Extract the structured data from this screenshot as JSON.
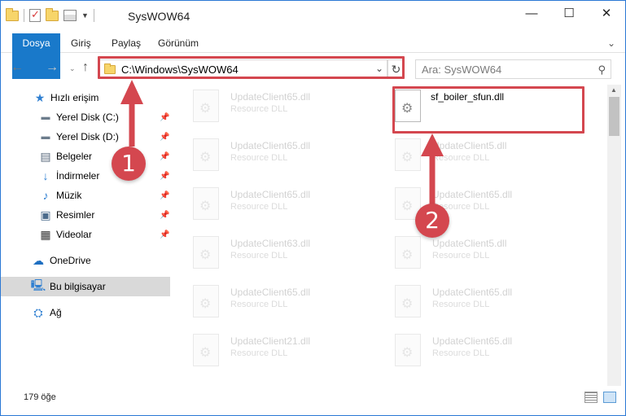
{
  "window": {
    "title": "SysWOW64",
    "minimize_glyph": "—",
    "maximize_glyph": "☐",
    "close_glyph": "✕"
  },
  "ribbon": {
    "tabs": [
      {
        "label": "Dosya"
      },
      {
        "label": "Giriş"
      },
      {
        "label": "Paylaş"
      },
      {
        "label": "Görünüm"
      }
    ]
  },
  "nav": {
    "address_value": "C:\\Windows\\SysWOW64",
    "search_placeholder": "Ara: SysWOW64"
  },
  "sidebar": {
    "items": [
      {
        "label": "Hızlı erişim",
        "icon": "star-icon"
      },
      {
        "label": "Yerel Disk (C:)",
        "icon": "drive-icon",
        "pinned": true
      },
      {
        "label": "Yerel Disk (D:)",
        "icon": "drive-icon",
        "pinned": true
      },
      {
        "label": "Belgeler",
        "icon": "documents-icon",
        "pinned": true
      },
      {
        "label": "İndirmeler",
        "icon": "downloads-icon",
        "pinned": true
      },
      {
        "label": "Müzik",
        "icon": "music-icon",
        "pinned": true
      },
      {
        "label": "Resimler",
        "icon": "pictures-icon",
        "pinned": true
      },
      {
        "label": "Videolar",
        "icon": "videos-icon",
        "pinned": true
      },
      {
        "label": "OneDrive",
        "icon": "cloud-icon"
      },
      {
        "label": "Bu bilgisayar",
        "icon": "computer-icon",
        "selected": true
      },
      {
        "label": "Ağ",
        "icon": "network-icon"
      }
    ]
  },
  "files": [
    {
      "name": "UpdateClient65.dll",
      "type": "Resource DLL"
    },
    {
      "name": "sf_boiler_sfun.dll",
      "type": "",
      "active": true
    },
    {
      "name": "UpdateClient65.dll",
      "type": "Resource DLL"
    },
    {
      "name": "UpdateClient5.dll",
      "type": "Resource DLL"
    },
    {
      "name": "UpdateClient65.dll",
      "type": "Resource DLL"
    },
    {
      "name": "UpdateClient65.dll",
      "type": "Resource DLL"
    },
    {
      "name": "UpdateClient63.dll",
      "type": "Resource DLL"
    },
    {
      "name": "UpdateClient5.dll",
      "type": "Resource DLL"
    },
    {
      "name": "UpdateClient65.dll",
      "type": "Resource DLL"
    },
    {
      "name": "UpdateClient65.dll",
      "type": "Resource DLL"
    },
    {
      "name": "UpdateClient21.dll",
      "type": "Resource DLL"
    },
    {
      "name": "UpdateClient65.dll",
      "type": "Resource DLL"
    }
  ],
  "status": {
    "item_count": "179 öğe"
  },
  "annotations": {
    "step1": "1",
    "step2": "2",
    "accent_color": "#d4474f"
  }
}
